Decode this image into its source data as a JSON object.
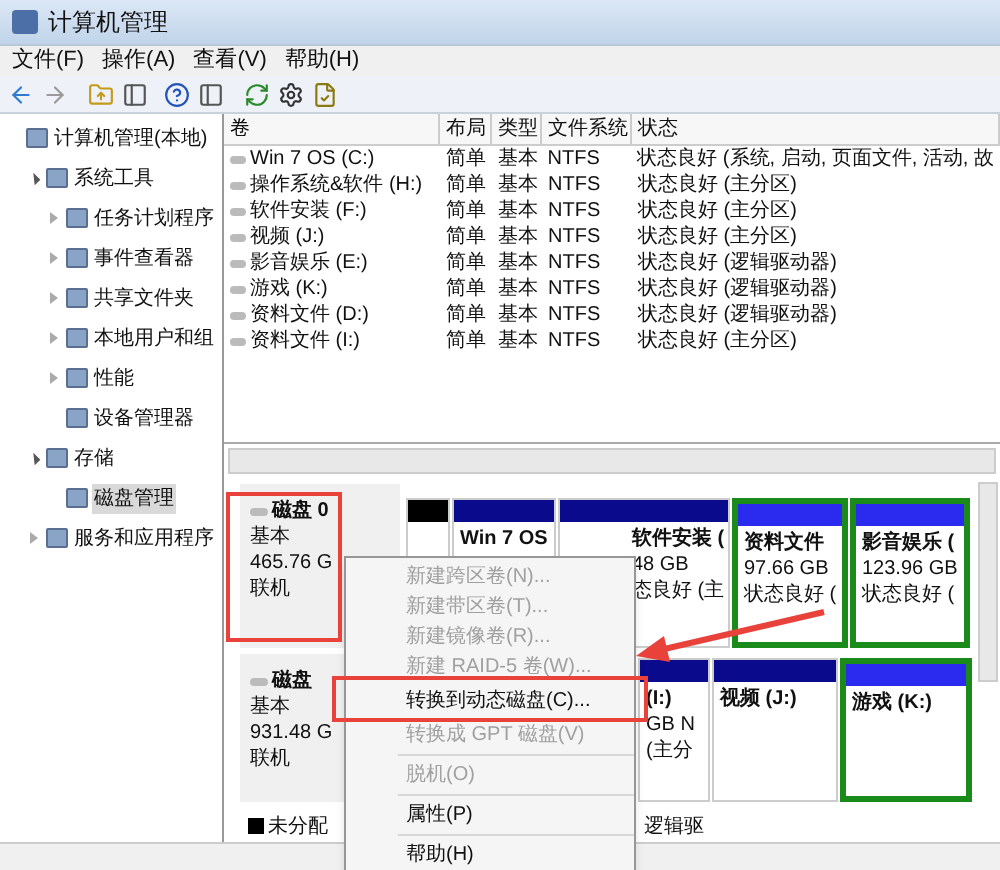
{
  "window": {
    "title": "计算机管理"
  },
  "menu": [
    "文件(F)",
    "操作(A)",
    "查看(V)",
    "帮助(H)"
  ],
  "tree": [
    {
      "label": "计算机管理(本地)",
      "selected": false,
      "children": [
        {
          "label": "系统工具",
          "expanded": true,
          "selected": false,
          "children": [
            {
              "label": "任务计划程序",
              "expanded": false,
              "selected": false
            },
            {
              "label": "事件查看器",
              "expanded": false,
              "selected": false
            },
            {
              "label": "共享文件夹",
              "expanded": false,
              "selected": false
            },
            {
              "label": "本地用户和组",
              "expanded": false,
              "selected": false
            },
            {
              "label": "性能",
              "expanded": false,
              "selected": false
            },
            {
              "label": "设备管理器",
              "selected": false
            }
          ]
        },
        {
          "label": "存储",
          "expanded": true,
          "selected": false,
          "children": [
            {
              "label": "磁盘管理",
              "selected": true
            }
          ]
        },
        {
          "label": "服务和应用程序",
          "expanded": false,
          "selected": false
        }
      ]
    }
  ],
  "volumes": {
    "columns": [
      "卷",
      "布局",
      "类型",
      "文件系统",
      "状态"
    ],
    "rows": [
      [
        "Win 7 OS  (C:)",
        "简单",
        "基本",
        "NTFS",
        "状态良好 (系统, 启动, 页面文件, 活动, 故"
      ],
      [
        "操作系统&软件 (H:)",
        "简单",
        "基本",
        "NTFS",
        "状态良好 (主分区)"
      ],
      [
        "软件安装 (F:)",
        "简单",
        "基本",
        "NTFS",
        "状态良好 (主分区)"
      ],
      [
        "视频 (J:)",
        "简单",
        "基本",
        "NTFS",
        "状态良好 (主分区)"
      ],
      [
        "影音娱乐 (E:)",
        "简单",
        "基本",
        "NTFS",
        "状态良好 (逻辑驱动器)"
      ],
      [
        "游戏 (K:)",
        "简单",
        "基本",
        "NTFS",
        "状态良好 (逻辑驱动器)"
      ],
      [
        "资料文件 (D:)",
        "简单",
        "基本",
        "NTFS",
        "状态良好 (逻辑驱动器)"
      ],
      [
        "资料文件 (I:)",
        "简单",
        "基本",
        "NTFS",
        "状态良好 (主分区)"
      ]
    ]
  },
  "disks": [
    {
      "name": "磁盘 0",
      "type": "基本",
      "size": "465.76 G",
      "status": "联机",
      "partitions": [
        {
          "kind": "unallocated"
        },
        {
          "kind": "primary",
          "name": "Win 7 OS"
        },
        {
          "kind": "primary",
          "name": "软件安装 (",
          "size": "48 GB",
          "status": "态良好 (主"
        },
        {
          "kind": "logical",
          "name": "资料文件",
          "size": "97.66 GB",
          "status": "状态良好 ("
        },
        {
          "kind": "logical",
          "name": "影音娱乐 (",
          "size": "123.96 GB",
          "status": "状态良好 ("
        }
      ]
    },
    {
      "name": "磁盘",
      "type": "基本",
      "size": "931.48 G",
      "status": "联机",
      "partitions": [
        {
          "kind": "primary",
          "name": "(I:)",
          "size": "GB N",
          "status": "(主分"
        },
        {
          "kind": "primary",
          "name": "视频 (J:)"
        },
        {
          "kind": "logical",
          "name": "游戏 (K:)"
        }
      ]
    }
  ],
  "legend": [
    {
      "label": "未分配",
      "color": "#000000"
    },
    {
      "label": "逻辑驱"
    }
  ],
  "context_menu": [
    {
      "kind": "item",
      "label": "新建跨区卷(N)...",
      "disabled": true
    },
    {
      "kind": "item",
      "label": "新建带区卷(T)...",
      "disabled": true
    },
    {
      "kind": "item",
      "label": "新建镜像卷(R)...",
      "disabled": true
    },
    {
      "kind": "item",
      "label": "新建 RAID-5 卷(W)...",
      "disabled": true
    },
    {
      "kind": "item",
      "label": "转换到动态磁盘(C)...",
      "disabled": false
    },
    {
      "kind": "item",
      "label": "转换成 GPT 磁盘(V)",
      "disabled": true
    },
    {
      "kind": "separator"
    },
    {
      "kind": "item",
      "label": "脱机(O)",
      "disabled": true
    },
    {
      "kind": "separator"
    },
    {
      "kind": "item",
      "label": "属性(P)",
      "disabled": false
    },
    {
      "kind": "separator"
    },
    {
      "kind": "item",
      "label": "帮助(H)",
      "disabled": false
    }
  ]
}
